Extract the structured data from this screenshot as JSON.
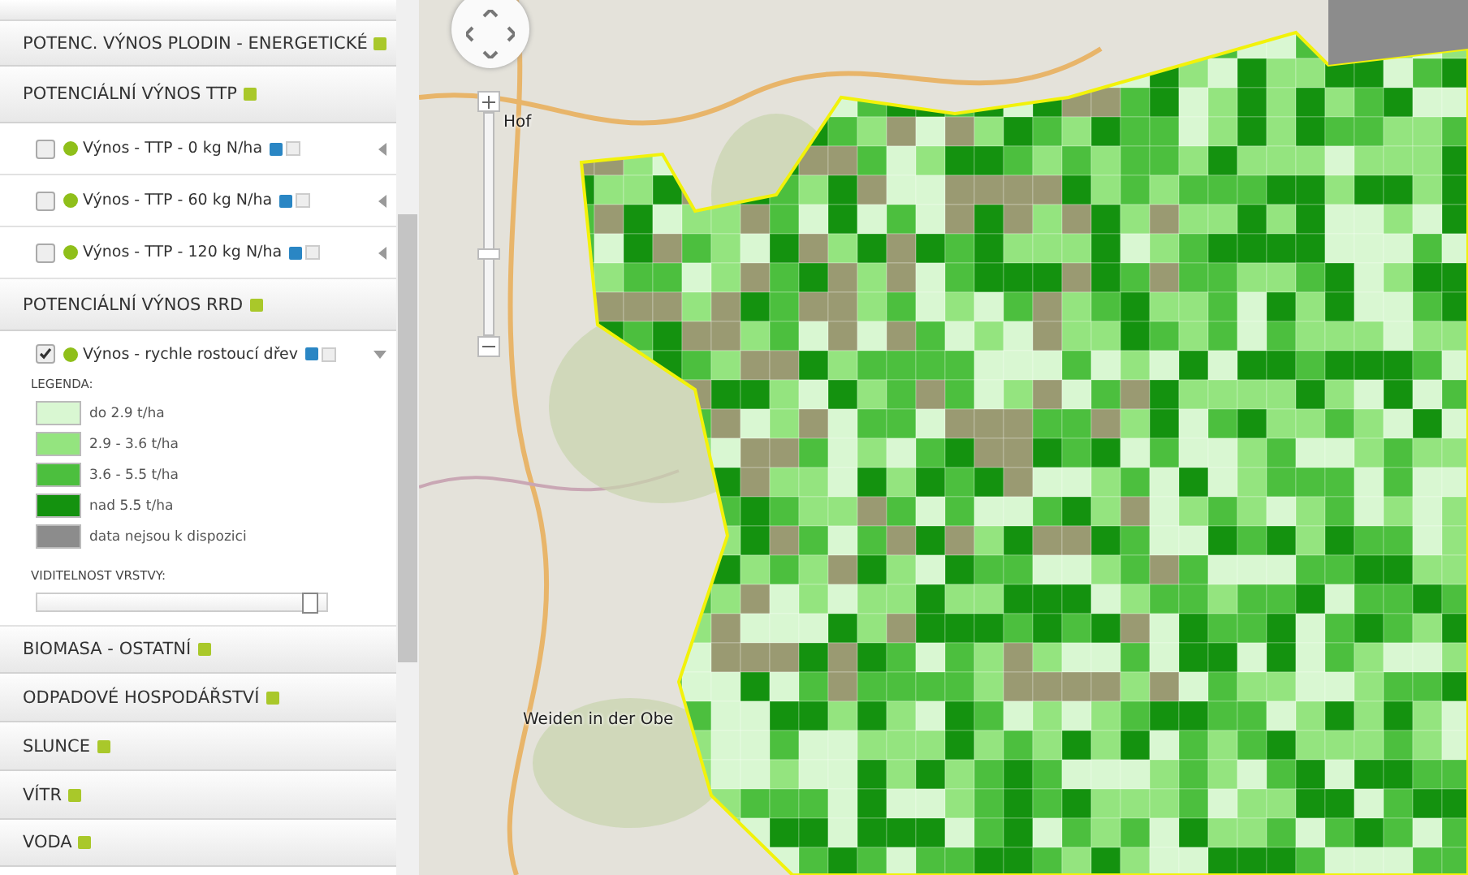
{
  "sidebar": {
    "sections": [
      {
        "kind": "header",
        "title": "POTENC. VÝNOS PLODIN - ENERGETICKÉ"
      },
      {
        "kind": "header",
        "title": "POTENCIÁLNÍ VÝNOS TTP"
      },
      {
        "kind": "layer",
        "label": "Výnos - TTP - 0 kg N/ha",
        "checked": false,
        "expanded": false
      },
      {
        "kind": "layer",
        "label": "Výnos - TTP - 60 kg N/ha",
        "checked": false,
        "expanded": false
      },
      {
        "kind": "layer",
        "label": "Výnos - TTP - 120 kg N/ha",
        "checked": false,
        "expanded": false
      },
      {
        "kind": "header",
        "title": "POTENCIÁLNÍ VÝNOS RRD"
      },
      {
        "kind": "layer",
        "label": "Výnos - rychle rostoucí dřev",
        "checked": true,
        "expanded": true,
        "legend_title": "LEGENDA:",
        "legend": [
          {
            "label": "do 2.9 t/ha",
            "color": "#d9f7d2"
          },
          {
            "label": "2.9 - 3.6 t/ha",
            "color": "#94e47f"
          },
          {
            "label": "3.6 - 5.5 t/ha",
            "color": "#4cbf3e"
          },
          {
            "label": "nad 5.5 t/ha",
            "color": "#14920f"
          },
          {
            "label": "data nejsou k dispozici",
            "color": "#8c8c8c"
          }
        ],
        "opacity_title": "VIDITELNOST VRSTVY:",
        "opacity": {
          "level": 0.96
        }
      },
      {
        "kind": "header",
        "title": "BIOMASA - OSTATNÍ"
      },
      {
        "kind": "header",
        "title": "ODPADOVÉ HOSPODÁŘSTVÍ"
      },
      {
        "kind": "header",
        "title": "SLUNCE"
      },
      {
        "kind": "header",
        "title": "VÍTR"
      },
      {
        "kind": "header",
        "title": "VODA"
      }
    ]
  },
  "map": {
    "zoom": {
      "level": 0.35
    },
    "places": [
      {
        "name": "Hof"
      },
      {
        "name": "Weiden in der Obe"
      }
    ]
  }
}
